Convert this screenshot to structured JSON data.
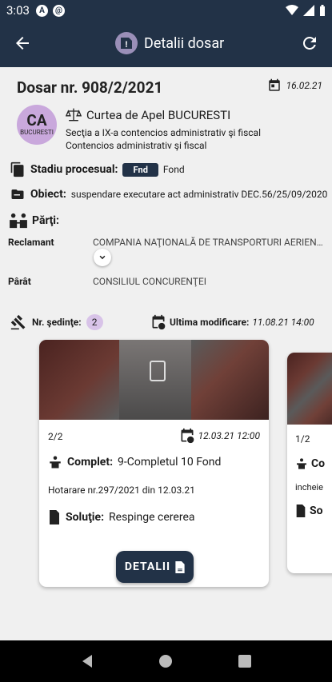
{
  "status_bar": {
    "time": "3:03",
    "icons": [
      "notification-a-icon",
      "notification-at-icon",
      "wifi-icon",
      "signal-icon",
      "battery-icon"
    ]
  },
  "app_bar": {
    "title": "Detalii dosar"
  },
  "case": {
    "title": "Dosar nr. 908/2/2021",
    "date": "16.02.21",
    "avatar_initials": "CA",
    "avatar_city": "BUCURESTI",
    "court": "Curtea de Apel BUCURESTI",
    "section": "Secţia a IX-a contencios administrativ şi fiscal",
    "subject_matter": "Contencios administrativ şi fiscal",
    "stage_label": "Stadiu procesual:",
    "stage_badge": "Fnd",
    "stage_value": "Fond",
    "object_label": "Obiect:",
    "object_value": "suspendare executare act administrativ DEC.56/25/09/2020",
    "parties_label": "Părţi:",
    "parties": [
      {
        "role": "Reclamant",
        "name": "COMPANIA NAŢIONALĂ DE TRANSPORTURI AERIENE ROMÂNE TAROM SA"
      },
      {
        "role": "Pârât",
        "name": "CONSILIUL CONCURENŢEI"
      }
    ],
    "hearings_label": "Nr. şedinţe:",
    "hearings_count": "2",
    "last_mod_label": "Ultima modificare:",
    "last_mod_value": "11.08.21 14:00"
  },
  "hearings": [
    {
      "index": "2/2",
      "datetime": "12.03.21 12:00",
      "complet_label": "Complet:",
      "complet_value": "9-Completul 10 Fond",
      "document": "Hotarare nr.297/2021 din 12.03.21",
      "solution_label": "Soluţie:",
      "solution_value": "Respinge cererea",
      "button": "DETALII"
    },
    {
      "index": "1/2",
      "complet_label": "Co",
      "document": "incheie",
      "solution_label": "So"
    }
  ],
  "colors": {
    "primary": "#223247",
    "avatar": "#c9a8dc",
    "badge": "#d8c3e8",
    "background": "#f0f0f0"
  }
}
